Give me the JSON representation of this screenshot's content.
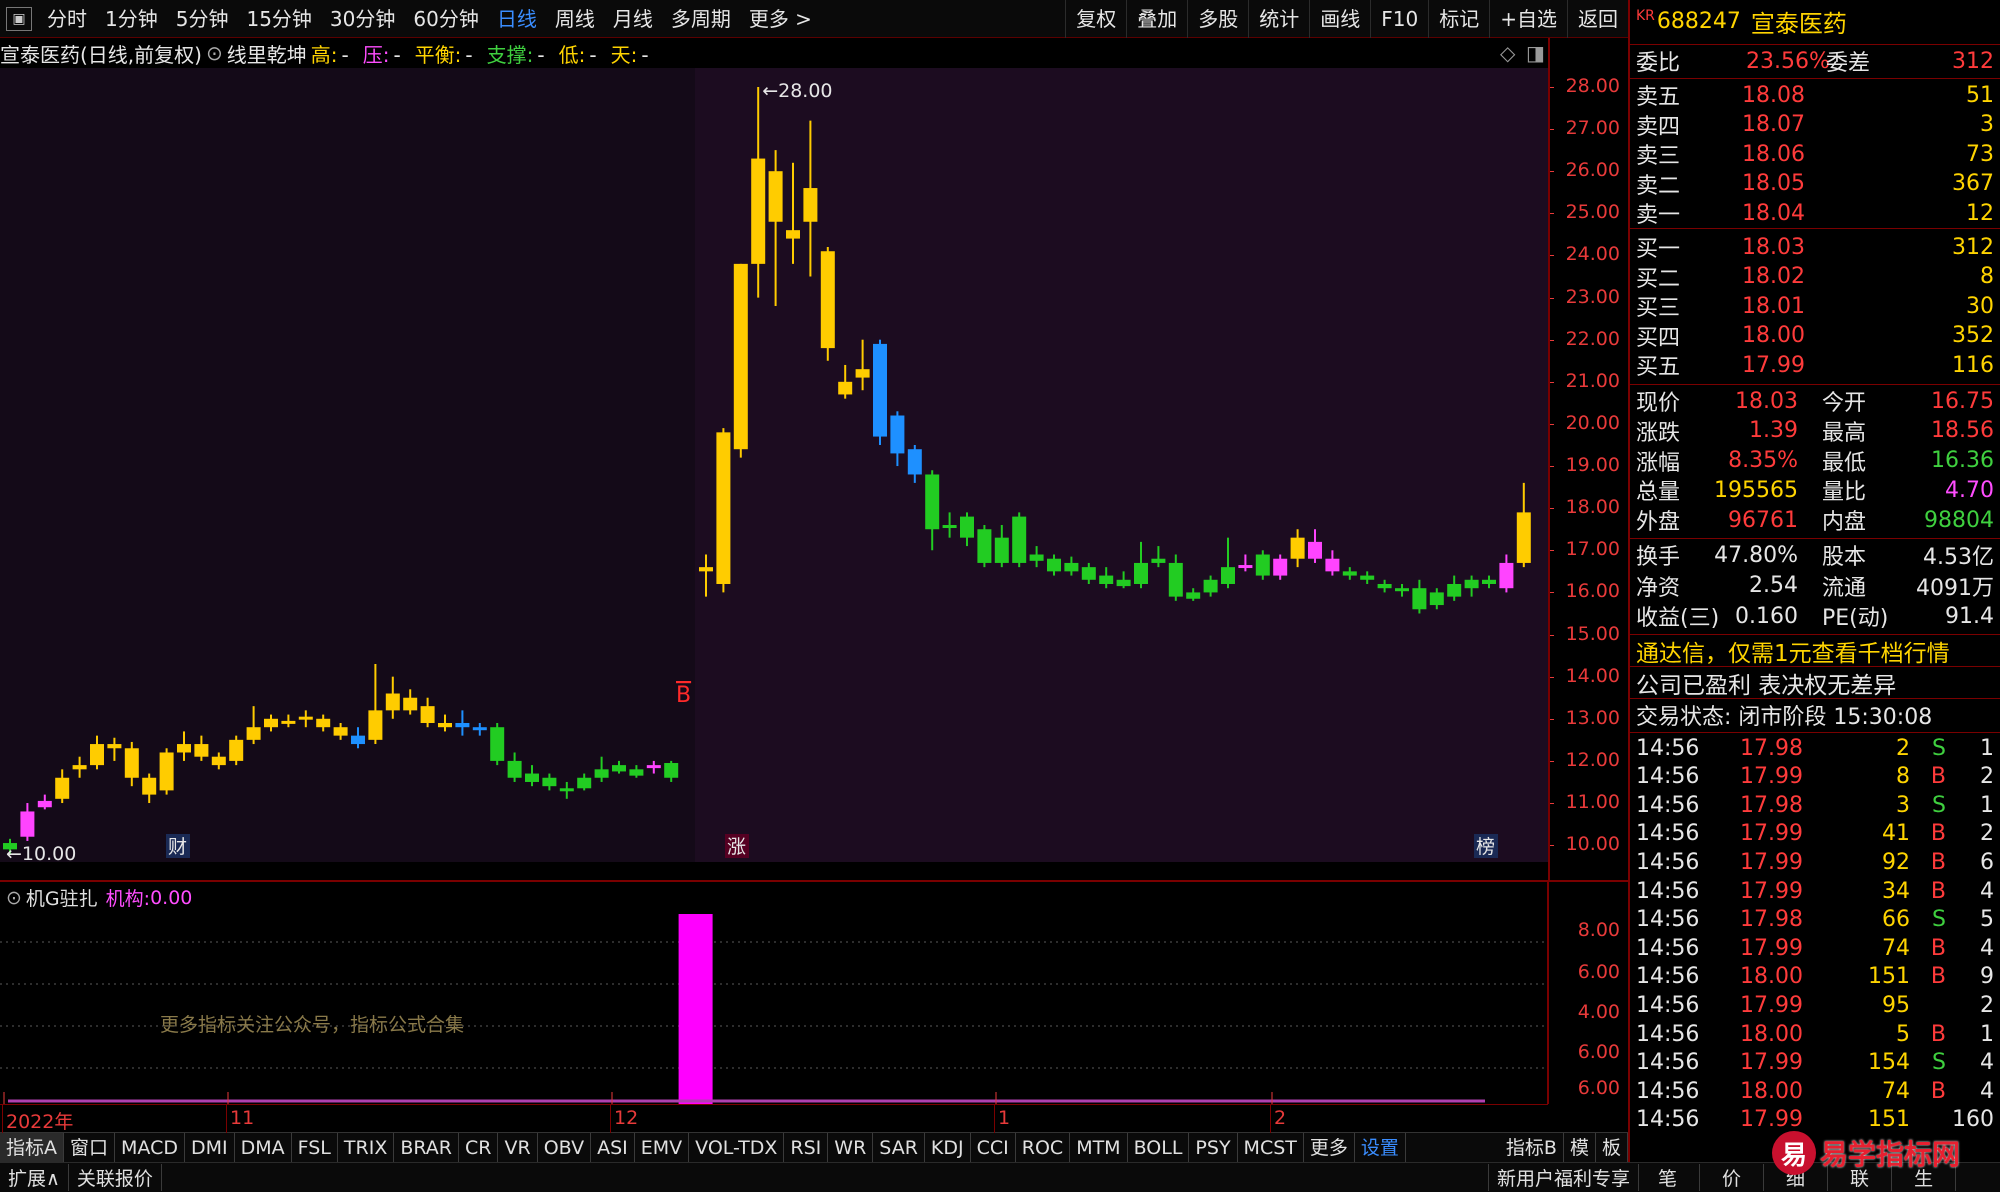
{
  "toolbar": {
    "periods": [
      "分时",
      "1分钟",
      "5分钟",
      "15分钟",
      "30分钟",
      "60分钟",
      "日线",
      "周线",
      "月线",
      "多周期",
      "更多 >"
    ],
    "active_index": 6,
    "tools": [
      "复权",
      "叠加",
      "多股",
      "统计",
      "画线",
      "F10",
      "标记",
      "+自选",
      "返回"
    ]
  },
  "chart": {
    "stock_title": "宣泰医药(日线,前复权)",
    "indicator_name": "线里乾坤",
    "fields": [
      {
        "label": "高:",
        "value": "-",
        "color": "#ffd400"
      },
      {
        "label": "压:",
        "value": "-",
        "color": "#ff4dff"
      },
      {
        "label": "平衡:",
        "value": "-",
        "color": "#ffd400"
      },
      {
        "label": "支撑:",
        "value": "-",
        "color": "#3fd03f"
      },
      {
        "label": "低:",
        "value": "-",
        "color": "#ffd400"
      },
      {
        "label": "天:",
        "value": "-",
        "color": "#ffd400"
      }
    ],
    "high_label": "28.00",
    "low_label": "10.00",
    "b_marker": "B",
    "event_tags": [
      "财",
      "涨",
      "榜"
    ],
    "axis_ticks": [
      "28.00",
      "27.00",
      "26.00",
      "25.00",
      "24.00",
      "23.00",
      "22.00",
      "21.00",
      "20.00",
      "19.00",
      "18.00",
      "17.00",
      "16.00",
      "15.00",
      "14.00",
      "13.00",
      "12.00",
      "11.00",
      "10.00"
    ],
    "date_labels": [
      "2022年",
      "11",
      "12",
      "1",
      "2"
    ]
  },
  "chart_data": {
    "type": "candlestick",
    "ylim": [
      9.5,
      28.3
    ],
    "candles": [
      {
        "o": 9.9,
        "h": 10.15,
        "l": 9.8,
        "c": 10.05,
        "col": "g"
      },
      {
        "o": 10.2,
        "h": 11.0,
        "l": 10.1,
        "c": 10.8,
        "col": "m"
      },
      {
        "o": 10.9,
        "h": 11.2,
        "l": 10.85,
        "c": 11.05,
        "col": "m"
      },
      {
        "o": 11.1,
        "h": 11.8,
        "l": 11.0,
        "c": 11.6,
        "col": "y"
      },
      {
        "o": 11.8,
        "h": 12.1,
        "l": 11.6,
        "c": 11.9,
        "col": "y"
      },
      {
        "o": 11.9,
        "h": 12.6,
        "l": 11.8,
        "c": 12.4,
        "col": "y"
      },
      {
        "o": 12.4,
        "h": 12.55,
        "l": 12.0,
        "c": 12.3,
        "col": "y"
      },
      {
        "o": 12.3,
        "h": 12.45,
        "l": 11.4,
        "c": 11.6,
        "col": "y"
      },
      {
        "o": 11.6,
        "h": 11.7,
        "l": 11.0,
        "c": 11.2,
        "col": "y"
      },
      {
        "o": 11.3,
        "h": 12.3,
        "l": 11.2,
        "c": 12.2,
        "col": "y"
      },
      {
        "o": 12.2,
        "h": 12.7,
        "l": 12.0,
        "c": 12.4,
        "col": "y"
      },
      {
        "o": 12.4,
        "h": 12.6,
        "l": 12.0,
        "c": 12.1,
        "col": "y"
      },
      {
        "o": 12.1,
        "h": 12.2,
        "l": 11.8,
        "c": 11.9,
        "col": "y"
      },
      {
        "o": 12.0,
        "h": 12.6,
        "l": 11.9,
        "c": 12.5,
        "col": "y"
      },
      {
        "o": 12.5,
        "h": 13.3,
        "l": 12.4,
        "c": 12.8,
        "col": "y"
      },
      {
        "o": 12.8,
        "h": 13.1,
        "l": 12.7,
        "c": 13.0,
        "col": "y"
      },
      {
        "o": 12.9,
        "h": 13.1,
        "l": 12.8,
        "c": 12.95,
        "col": "y"
      },
      {
        "o": 13.0,
        "h": 13.2,
        "l": 12.8,
        "c": 13.05,
        "col": "y"
      },
      {
        "o": 13.0,
        "h": 13.1,
        "l": 12.7,
        "c": 12.8,
        "col": "y"
      },
      {
        "o": 12.8,
        "h": 12.9,
        "l": 12.5,
        "c": 12.6,
        "col": "y"
      },
      {
        "o": 12.6,
        "h": 12.8,
        "l": 12.3,
        "c": 12.4,
        "col": "b"
      },
      {
        "o": 12.5,
        "h": 14.3,
        "l": 12.4,
        "c": 13.2,
        "col": "y"
      },
      {
        "o": 13.2,
        "h": 14.0,
        "l": 13.0,
        "c": 13.6,
        "col": "y"
      },
      {
        "o": 13.5,
        "h": 13.7,
        "l": 13.1,
        "c": 13.2,
        "col": "y"
      },
      {
        "o": 13.3,
        "h": 13.5,
        "l": 12.8,
        "c": 12.9,
        "col": "y"
      },
      {
        "o": 12.9,
        "h": 13.1,
        "l": 12.7,
        "c": 12.8,
        "col": "y"
      },
      {
        "o": 12.9,
        "h": 13.2,
        "l": 12.6,
        "c": 12.8,
        "col": "b"
      },
      {
        "o": 12.8,
        "h": 12.9,
        "l": 12.6,
        "c": 12.75,
        "col": "b"
      },
      {
        "o": 12.8,
        "h": 12.9,
        "l": 11.9,
        "c": 12.0,
        "col": "g"
      },
      {
        "o": 12.0,
        "h": 12.2,
        "l": 11.5,
        "c": 11.6,
        "col": "g"
      },
      {
        "o": 11.7,
        "h": 11.9,
        "l": 11.4,
        "c": 11.5,
        "col": "g"
      },
      {
        "o": 11.6,
        "h": 11.7,
        "l": 11.3,
        "c": 11.4,
        "col": "g"
      },
      {
        "o": 11.35,
        "h": 11.5,
        "l": 11.1,
        "c": 11.3,
        "col": "g"
      },
      {
        "o": 11.6,
        "h": 11.7,
        "l": 11.3,
        "c": 11.35,
        "col": "g"
      },
      {
        "o": 11.8,
        "h": 12.1,
        "l": 11.5,
        "c": 11.6,
        "col": "g"
      },
      {
        "o": 11.9,
        "h": 12.0,
        "l": 11.7,
        "c": 11.75,
        "col": "g"
      },
      {
        "o": 11.8,
        "h": 11.9,
        "l": 11.6,
        "c": 11.65,
        "col": "g"
      },
      {
        "o": 11.85,
        "h": 12.0,
        "l": 11.7,
        "c": 11.9,
        "col": "m"
      },
      {
        "o": 11.95,
        "h": 12.0,
        "l": 11.5,
        "c": 11.6,
        "col": "g"
      },
      null,
      {
        "o": 16.5,
        "h": 16.9,
        "l": 15.9,
        "c": 16.6,
        "col": "y"
      },
      {
        "o": 16.2,
        "h": 19.9,
        "l": 16.0,
        "c": 19.8,
        "col": "y"
      },
      {
        "o": 19.4,
        "h": 23.8,
        "l": 19.2,
        "c": 23.8,
        "col": "y"
      },
      {
        "o": 23.8,
        "h": 28.0,
        "l": 23.0,
        "c": 26.3,
        "col": "y"
      },
      {
        "o": 26.0,
        "h": 26.5,
        "l": 22.8,
        "c": 24.8,
        "col": "y"
      },
      {
        "o": 24.4,
        "h": 26.2,
        "l": 23.8,
        "c": 24.6,
        "col": "y"
      },
      {
        "o": 24.8,
        "h": 27.2,
        "l": 23.5,
        "c": 25.6,
        "col": "y"
      },
      {
        "o": 24.1,
        "h": 24.2,
        "l": 21.5,
        "c": 21.8,
        "col": "y"
      },
      {
        "o": 21.0,
        "h": 21.4,
        "l": 20.6,
        "c": 20.7,
        "col": "y"
      },
      {
        "o": 21.1,
        "h": 22.0,
        "l": 20.8,
        "c": 21.3,
        "col": "y"
      },
      {
        "o": 21.9,
        "h": 22.0,
        "l": 19.5,
        "c": 19.7,
        "col": "b"
      },
      {
        "o": 20.2,
        "h": 20.3,
        "l": 19.0,
        "c": 19.3,
        "col": "b"
      },
      {
        "o": 19.4,
        "h": 19.5,
        "l": 18.6,
        "c": 18.8,
        "col": "b"
      },
      {
        "o": 18.8,
        "h": 18.9,
        "l": 17.0,
        "c": 17.5,
        "col": "g"
      },
      {
        "o": 17.6,
        "h": 17.9,
        "l": 17.3,
        "c": 17.55,
        "col": "g"
      },
      {
        "o": 17.8,
        "h": 17.9,
        "l": 17.1,
        "c": 17.3,
        "col": "g"
      },
      {
        "o": 17.5,
        "h": 17.6,
        "l": 16.6,
        "c": 16.7,
        "col": "g"
      },
      {
        "o": 17.3,
        "h": 17.6,
        "l": 16.6,
        "c": 16.7,
        "col": "g"
      },
      {
        "o": 17.8,
        "h": 17.9,
        "l": 16.6,
        "c": 16.7,
        "col": "g"
      },
      {
        "o": 16.9,
        "h": 17.1,
        "l": 16.6,
        "c": 16.75,
        "col": "g"
      },
      {
        "o": 16.8,
        "h": 16.9,
        "l": 16.4,
        "c": 16.5,
        "col": "g"
      },
      {
        "o": 16.7,
        "h": 16.85,
        "l": 16.4,
        "c": 16.5,
        "col": "g"
      },
      {
        "o": 16.6,
        "h": 16.7,
        "l": 16.2,
        "c": 16.3,
        "col": "g"
      },
      {
        "o": 16.4,
        "h": 16.6,
        "l": 16.1,
        "c": 16.2,
        "col": "g"
      },
      {
        "o": 16.3,
        "h": 16.5,
        "l": 16.1,
        "c": 16.15,
        "col": "g"
      },
      {
        "o": 16.7,
        "h": 17.2,
        "l": 16.1,
        "c": 16.2,
        "col": "g"
      },
      {
        "o": 16.8,
        "h": 17.1,
        "l": 16.6,
        "c": 16.7,
        "col": "g"
      },
      {
        "o": 16.7,
        "h": 16.9,
        "l": 15.8,
        "c": 15.9,
        "col": "g"
      },
      {
        "o": 16.0,
        "h": 16.1,
        "l": 15.8,
        "c": 15.85,
        "col": "g"
      },
      {
        "o": 16.3,
        "h": 16.4,
        "l": 15.9,
        "c": 16.0,
        "col": "g"
      },
      {
        "o": 16.6,
        "h": 17.3,
        "l": 16.1,
        "c": 16.2,
        "col": "g"
      },
      {
        "o": 16.6,
        "h": 16.9,
        "l": 16.5,
        "c": 16.65,
        "col": "m"
      },
      {
        "o": 16.9,
        "h": 17.0,
        "l": 16.3,
        "c": 16.4,
        "col": "g"
      },
      {
        "o": 16.4,
        "h": 16.9,
        "l": 16.3,
        "c": 16.8,
        "col": "m"
      },
      {
        "o": 16.8,
        "h": 17.5,
        "l": 16.6,
        "c": 17.3,
        "col": "y"
      },
      {
        "o": 16.8,
        "h": 17.5,
        "l": 16.7,
        "c": 17.2,
        "col": "m"
      },
      {
        "o": 16.5,
        "h": 17.0,
        "l": 16.4,
        "c": 16.8,
        "col": "m"
      },
      {
        "o": 16.5,
        "h": 16.6,
        "l": 16.3,
        "c": 16.4,
        "col": "g"
      },
      {
        "o": 16.4,
        "h": 16.5,
        "l": 16.2,
        "c": 16.3,
        "col": "g"
      },
      {
        "o": 16.2,
        "h": 16.3,
        "l": 16.0,
        "c": 16.1,
        "col": "g"
      },
      {
        "o": 16.1,
        "h": 16.2,
        "l": 15.9,
        "c": 16.05,
        "col": "g"
      },
      {
        "o": 16.1,
        "h": 16.3,
        "l": 15.5,
        "c": 15.6,
        "col": "g"
      },
      {
        "o": 16.0,
        "h": 16.1,
        "l": 15.6,
        "c": 15.7,
        "col": "g"
      },
      {
        "o": 16.2,
        "h": 16.4,
        "l": 15.8,
        "c": 15.9,
        "col": "g"
      },
      {
        "o": 16.3,
        "h": 16.4,
        "l": 15.9,
        "c": 16.1,
        "col": "g"
      },
      {
        "o": 16.3,
        "h": 16.4,
        "l": 16.1,
        "c": 16.2,
        "col": "g"
      },
      {
        "o": 16.1,
        "h": 16.9,
        "l": 16.0,
        "c": 16.7,
        "col": "m"
      },
      {
        "o": 16.7,
        "h": 18.6,
        "l": 16.6,
        "c": 17.9,
        "col": "y"
      }
    ],
    "sub": {
      "ylim": [
        5.6,
        9.6
      ],
      "ticks": [
        "8.00",
        "6.00",
        "4.00",
        "6.00",
        "6.00"
      ],
      "bar_index": 39,
      "bar_value": 9.4
    }
  },
  "sub_pane": {
    "name": "机G驻扎",
    "field_label": "机构:",
    "field_value": "0.00",
    "note": "更多指标关注公众号，指标公式合集"
  },
  "panel": {
    "code": "688247",
    "name": "宣泰医药",
    "market": "KR",
    "wei_bi_label": "委比",
    "wei_bi": "23.56%",
    "wei_cha_label": "委差",
    "wei_cha": "312",
    "sell": [
      {
        "label": "卖五",
        "price": "18.08",
        "vol": "51"
      },
      {
        "label": "卖四",
        "price": "18.07",
        "vol": "3"
      },
      {
        "label": "卖三",
        "price": "18.06",
        "vol": "73"
      },
      {
        "label": "卖二",
        "price": "18.05",
        "vol": "367"
      },
      {
        "label": "卖一",
        "price": "18.04",
        "vol": "12"
      }
    ],
    "buy": [
      {
        "label": "买一",
        "price": "18.03",
        "vol": "312"
      },
      {
        "label": "买二",
        "price": "18.02",
        "vol": "8"
      },
      {
        "label": "买三",
        "price": "18.01",
        "vol": "30"
      },
      {
        "label": "买四",
        "price": "18.00",
        "vol": "352"
      },
      {
        "label": "买五",
        "price": "17.99",
        "vol": "116"
      }
    ],
    "stats": [
      {
        "l1": "现价",
        "v1": "18.03",
        "c1": "red",
        "l2": "今开",
        "v2": "16.75",
        "c2": "red"
      },
      {
        "l1": "涨跌",
        "v1": "1.39",
        "c1": "red",
        "l2": "最高",
        "v2": "18.56",
        "c2": "red"
      },
      {
        "l1": "涨幅",
        "v1": "8.35%",
        "c1": "red",
        "l2": "最低",
        "v2": "16.36",
        "c2": "green"
      },
      {
        "l1": "总量",
        "v1": "195565",
        "c1": "yellow",
        "l2": "量比",
        "v2": "4.70",
        "c2": "magenta"
      },
      {
        "l1": "外盘",
        "v1": "96761",
        "c1": "red",
        "l2": "内盘",
        "v2": "98804",
        "c2": "green"
      }
    ],
    "stats2": [
      {
        "l1": "换手",
        "v1": "47.80%",
        "l2": "股本",
        "v2": "4.53亿"
      },
      {
        "l1": "净资",
        "v1": "2.54",
        "l2": "流通",
        "v2": "4091万"
      },
      {
        "l1": "收益(三)",
        "v1": "0.160",
        "l2": "PE(动)",
        "v2": "91.4"
      }
    ],
    "promo": "通达信，仅需1元查看千档行情",
    "notice": "公司已盈利 表决权无差异",
    "trade_status": "交易状态: 闭市阶段 15:30:08",
    "ticks": [
      {
        "t": "14:56",
        "p": "17.98",
        "v": "2",
        "bs": "S",
        "n": "1"
      },
      {
        "t": "14:56",
        "p": "17.99",
        "v": "8",
        "bs": "B",
        "n": "2"
      },
      {
        "t": "14:56",
        "p": "17.98",
        "v": "3",
        "bs": "S",
        "n": "1"
      },
      {
        "t": "14:56",
        "p": "17.99",
        "v": "41",
        "bs": "B",
        "n": "2"
      },
      {
        "t": "14:56",
        "p": "17.99",
        "v": "92",
        "bs": "B",
        "n": "6"
      },
      {
        "t": "14:56",
        "p": "17.99",
        "v": "34",
        "bs": "B",
        "n": "4"
      },
      {
        "t": "14:56",
        "p": "17.98",
        "v": "66",
        "bs": "S",
        "n": "5"
      },
      {
        "t": "14:56",
        "p": "17.99",
        "v": "74",
        "bs": "B",
        "n": "4"
      },
      {
        "t": "14:56",
        "p": "18.00",
        "v": "151",
        "bs": "B",
        "n": "9"
      },
      {
        "t": "14:56",
        "p": "17.99",
        "v": "95",
        "bs": "",
        "n": "2"
      },
      {
        "t": "14:56",
        "p": "18.00",
        "v": "5",
        "bs": "B",
        "n": "1"
      },
      {
        "t": "14:56",
        "p": "17.99",
        "v": "154",
        "bs": "S",
        "n": "4"
      },
      {
        "t": "14:56",
        "p": "18.00",
        "v": "74",
        "bs": "B",
        "n": "4"
      },
      {
        "t": "14:56",
        "p": "17.99",
        "v": "151",
        "bs": "",
        "n": "160"
      }
    ]
  },
  "tabs": [
    "指标A",
    "窗口",
    "MACD",
    "DMI",
    "DMA",
    "FSL",
    "TRIX",
    "BRAR",
    "CR",
    "VR",
    "OBV",
    "ASI",
    "EMV",
    "VOL-TDX",
    "RSI",
    "WR",
    "SAR",
    "KDJ",
    "CCI",
    "ROC",
    "MTM",
    "BOLL",
    "PSY",
    "MCST",
    "更多",
    "设置"
  ],
  "tabs_right": [
    "指标B",
    "模",
    "板"
  ],
  "status": {
    "left": [
      "扩展∧",
      "关联报价"
    ],
    "promo": "新用户福利专享",
    "right": [
      "笔",
      "价",
      "细",
      "联",
      "生"
    ],
    "watermark": "易学指标网",
    "watermark_badge": "易"
  }
}
